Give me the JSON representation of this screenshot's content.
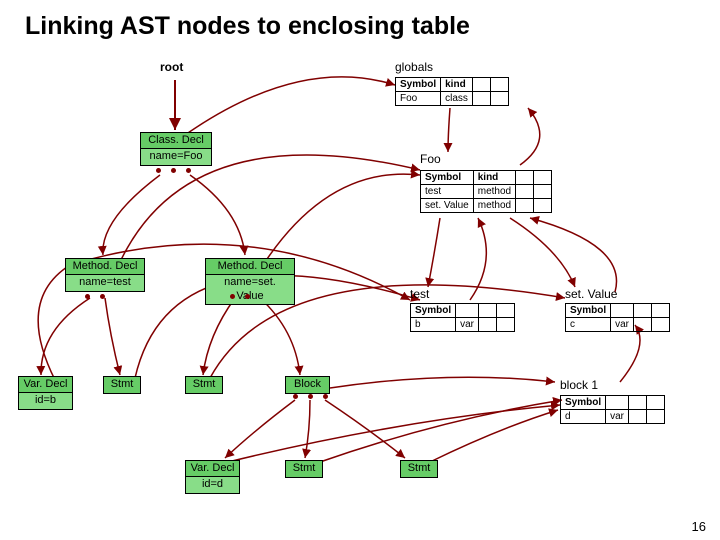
{
  "title": "Linking AST nodes to enclosing table",
  "page_number": "16",
  "root_label": "root",
  "nodes": {
    "classdecl": {
      "type": "Class. Decl",
      "detail": "name=Foo"
    },
    "method1": {
      "type": "Method. Decl",
      "detail": "name=test"
    },
    "method2": {
      "type": "Method. Decl",
      "detail": "name=set. Value"
    },
    "vardecl1": {
      "type": "Var. Decl",
      "detail": "id=b"
    },
    "stmt1": {
      "type": "Stmt"
    },
    "stmt2": {
      "type": "Stmt"
    },
    "block": {
      "type": "Block"
    },
    "vardecl2": {
      "type": "Var. Decl",
      "detail": "id=d"
    },
    "stmt3": {
      "type": "Stmt"
    },
    "stmt4": {
      "type": "Stmt"
    }
  },
  "scopes": {
    "globals": {
      "label": "globals",
      "headers": [
        "Symbol",
        "kind"
      ],
      "rows": [
        [
          "Foo",
          "class"
        ]
      ]
    },
    "foo": {
      "label": "Foo",
      "headers": [
        "Symbol",
        "kind"
      ],
      "rows": [
        [
          "test",
          "method"
        ],
        [
          "set. Value",
          "method"
        ]
      ]
    },
    "test": {
      "label": "test",
      "headers": [
        "Symbol"
      ],
      "rows": [
        [
          "b",
          "var"
        ]
      ]
    },
    "setvalue": {
      "label": "set. Value",
      "headers": [
        "Symbol"
      ],
      "rows": [
        [
          "c",
          "var"
        ]
      ]
    },
    "block1": {
      "label": "block 1",
      "headers": [
        "Symbol"
      ],
      "rows": [
        [
          "d",
          "var"
        ]
      ]
    }
  }
}
